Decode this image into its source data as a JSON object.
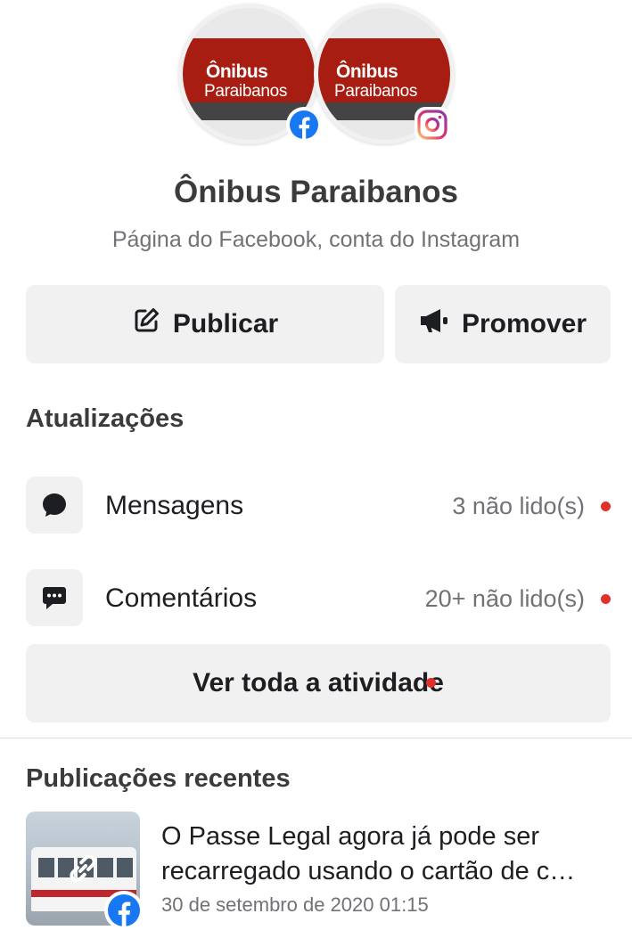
{
  "profile": {
    "logo_line1": "Ônibus",
    "logo_line2": "Paraibanos",
    "name": "Ônibus Paraibanos",
    "subtitle": "Página do Facebook, conta do Instagram"
  },
  "actions": {
    "publish_label": "Publicar",
    "promote_label": "Promover"
  },
  "updates": {
    "title": "Atualizações",
    "items": [
      {
        "label": "Mensagens",
        "count": "3 não lido(s)",
        "icon": "message-bubble-icon"
      },
      {
        "label": "Comentários",
        "count": "20+ não lido(s)",
        "icon": "comment-bubble-icon"
      }
    ],
    "see_all_label": "Ver toda a atividade"
  },
  "recent": {
    "title": "Publicações recentes",
    "posts": [
      {
        "text": "O Passe Legal agora já pode ser recarregado usando o cartão de c…",
        "date": "30 de setembro de 2020 01:15"
      }
    ]
  },
  "colors": {
    "facebook_blue": "#1877f2",
    "badge_red": "#e0322a",
    "button_bg": "#f1f1f2",
    "brand_red": "#a81d12"
  }
}
